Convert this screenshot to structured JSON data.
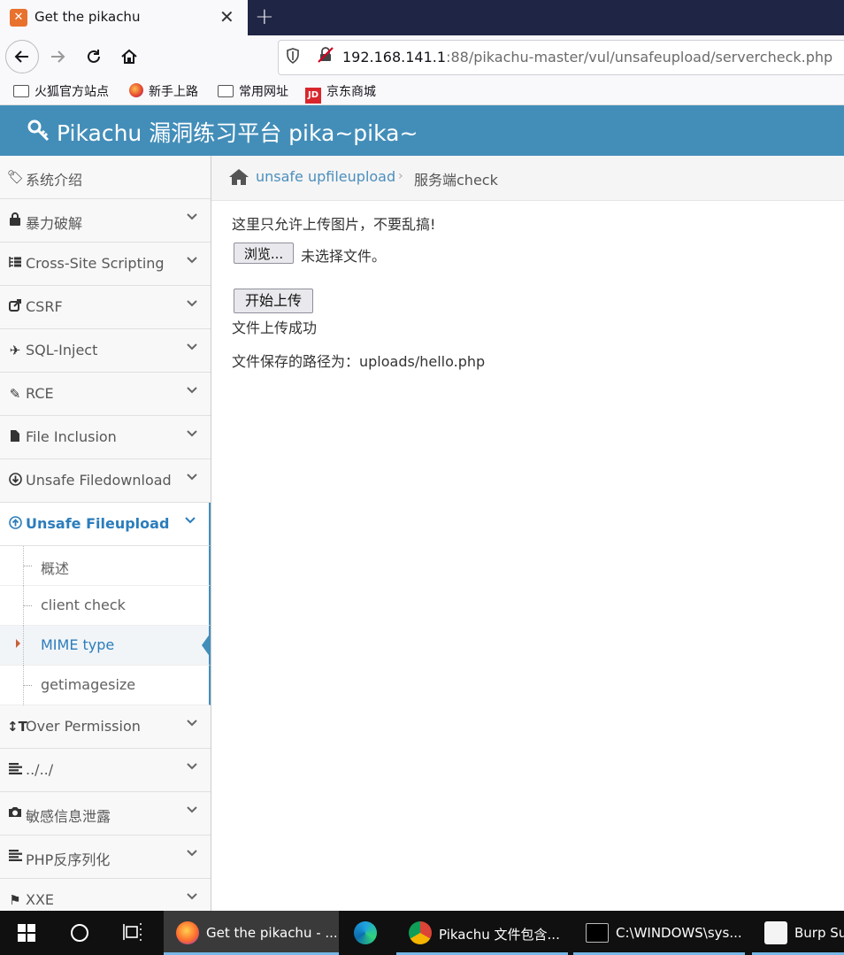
{
  "browser": {
    "tab_title": "Get the pikachu",
    "tab_close": "✕",
    "new_tab": "+",
    "url_host": "192.168.141.1",
    "url_rest": ":88/pikachu-master/vul/unsafeupload/servercheck.php",
    "bookmarks": [
      "火狐官方站点",
      "新手上路",
      "常用网址",
      "京东商城"
    ]
  },
  "header": {
    "title": "Pikachu 漏洞练习平台 pika~pika~"
  },
  "sidebar": {
    "items": [
      {
        "label": "系统介绍",
        "icon": "tags-icon"
      },
      {
        "label": "暴力破解",
        "icon": "lock-icon"
      },
      {
        "label": "Cross-Site Scripting",
        "icon": "list-tree-icon"
      },
      {
        "label": "CSRF",
        "icon": "share-icon"
      },
      {
        "label": "SQL-Inject",
        "icon": "plane-icon"
      },
      {
        "label": "RCE",
        "icon": "pencil-icon"
      },
      {
        "label": "File Inclusion",
        "icon": "file-icon"
      },
      {
        "label": "Unsafe Filedownload",
        "icon": "download-icon"
      },
      {
        "label": "Unsafe Fileupload",
        "icon": "upload-icon"
      },
      {
        "label": "Over Permission",
        "icon": "text-height-icon"
      },
      {
        "label": "../../",
        "icon": "align-left-icon"
      },
      {
        "label": "敏感信息泄露",
        "icon": "camera-icon"
      },
      {
        "label": "PHP反序列化",
        "icon": "align-left-icon"
      },
      {
        "label": "XXE",
        "icon": "flag-icon"
      }
    ],
    "subitems": [
      "概述",
      "client check",
      "MIME type",
      "getimagesize"
    ]
  },
  "breadcrumb": {
    "link": "unsafe upfileupload",
    "current": "服务端check",
    "sep": "›"
  },
  "content": {
    "notice": "这里只允许上传图片，不要乱搞!",
    "browse_label": "浏览...",
    "no_file": "未选择文件。",
    "upload_label": "开始上传",
    "result": "文件上传成功",
    "path": "文件保存的路径为：uploads/hello.php"
  },
  "taskbar": {
    "apps": [
      {
        "label": "Get the pikachu - ...",
        "icon": "firefox-icon"
      },
      {
        "label": "",
        "icon": "edge-beta-icon"
      },
      {
        "label": "Pikachu 文件包含...",
        "icon": "chrome-icon"
      },
      {
        "label": "C:\\WINDOWS\\sys...",
        "icon": "cmd-icon"
      },
      {
        "label": "Burp Sui",
        "icon": "java-icon"
      }
    ]
  },
  "colors": {
    "header": "#438eb9",
    "accent": "#2b7dbc",
    "tabbar": "#1f2544"
  }
}
